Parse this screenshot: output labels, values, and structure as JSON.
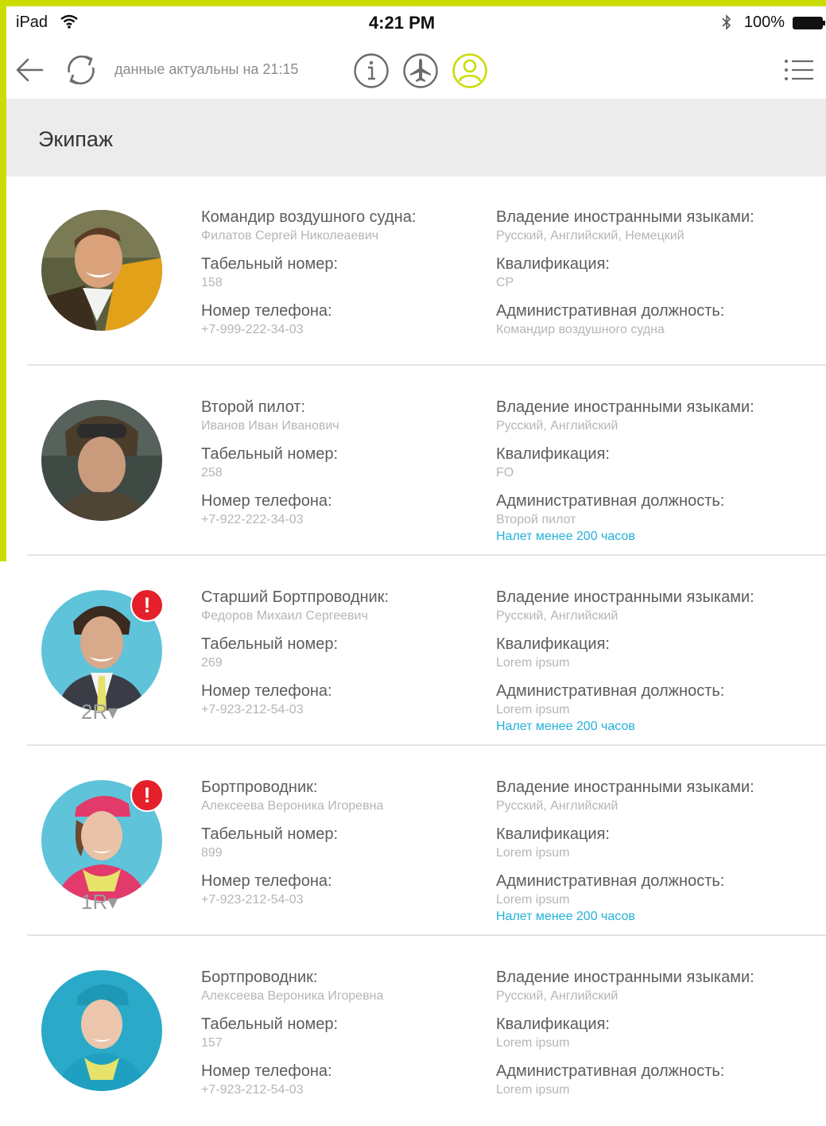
{
  "status_bar": {
    "device": "iPad",
    "time": "4:21 PM",
    "battery": "100%"
  },
  "toolbar": {
    "updated_text": "данные актуальны на 21:15",
    "icons": [
      "back-arrow-icon",
      "refresh-icon",
      "info-icon",
      "airplane-icon",
      "crew-person-icon",
      "list-menu-icon"
    ],
    "active_color": "#cbdc00"
  },
  "section": {
    "title": "Экипаж"
  },
  "labels": {
    "languages": "Владение иностранными языками:",
    "employee_no": "Табельный номер:",
    "qualification": "Квалификация:",
    "phone": "Номер телефона:",
    "position": "Административная должность:"
  },
  "crew": [
    {
      "role": "Командир воздушного судна:",
      "name": "Филатов Сергей Николеаевич",
      "employee_no": "158",
      "phone": "+7-999-222-34-03",
      "languages": "Русский, Английский, Немецкий",
      "qualification": "CP",
      "position": "Командир воздушного судна",
      "warning": "",
      "seat": "",
      "alert": false
    },
    {
      "role": "Второй пилот:",
      "name": "Иванов Иван Иванович",
      "employee_no": "258",
      "phone": "+7-922-222-34-03",
      "languages": "Русский, Английский",
      "qualification": "FO",
      "position": "Второй пилот",
      "warning": "Налет менее 200 часов",
      "seat": "",
      "alert": false
    },
    {
      "role": "Старший Бортпроводник:",
      "name": "Федоров Михаил Сергеевич",
      "employee_no": "269",
      "phone": "+7-923-212-54-03",
      "languages": "Русский, Английский",
      "qualification": "Lorem ipsum",
      "position": "Lorem ipsum",
      "warning": "Налет менее 200 часов",
      "seat": "2R▾",
      "alert": true
    },
    {
      "role": "Бортпроводник:",
      "name": "Алексеева Вероника Игоревна",
      "employee_no": "899",
      "phone": "+7-923-212-54-03",
      "languages": "Русский, Английский",
      "qualification": "Lorem ipsum",
      "position": "Lorem ipsum",
      "warning": "Налет менее 200 часов",
      "seat": "1R▾",
      "alert": true
    },
    {
      "role": "Бортпроводник:",
      "name": "Алексеева Вероника Игоревна",
      "employee_no": "157",
      "phone": "+7-923-212-54-03",
      "languages": "Русский, Английский",
      "qualification": "Lorem ipsum",
      "position": "Lorem ipsum",
      "warning": "",
      "seat": "",
      "alert": false
    }
  ],
  "colors": {
    "accent": "#cbdc00",
    "warning_text": "#23b1d8",
    "alert_badge": "#e5202a",
    "header_bg": "#ececec"
  }
}
